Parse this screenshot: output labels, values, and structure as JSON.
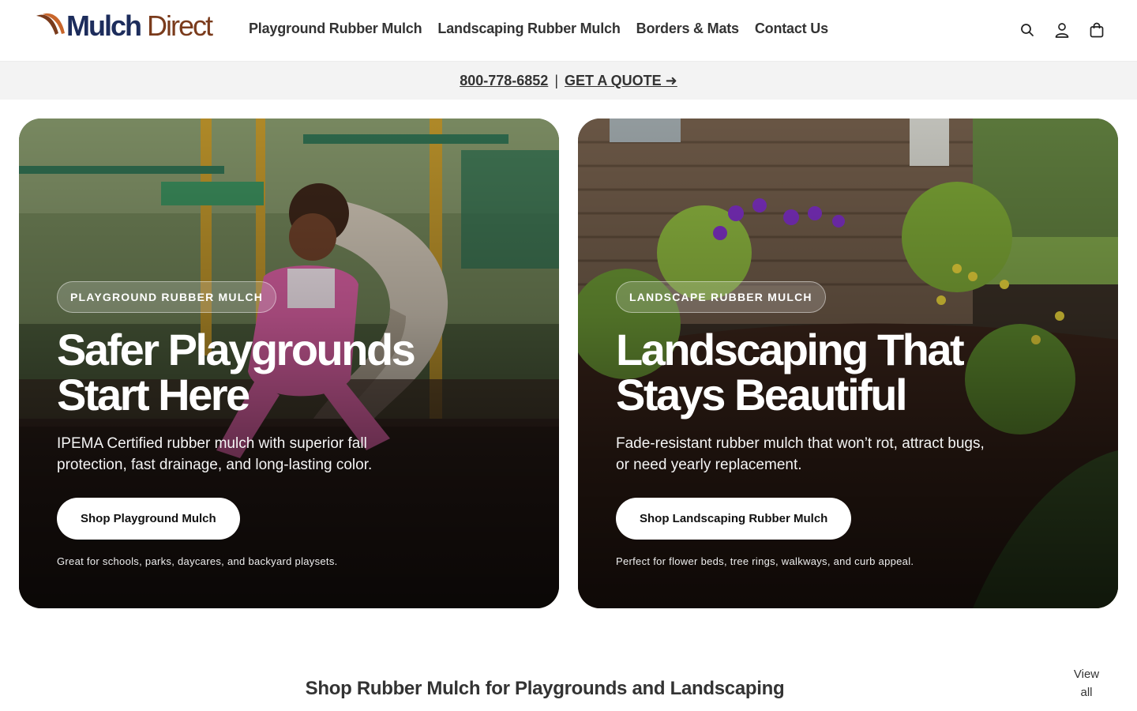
{
  "brand": {
    "name": "MulchDirect",
    "part1": "Mulch",
    "part2": "Direct",
    "colors": {
      "brown": "#7a3b1c",
      "navy": "#1d2d5c",
      "orange": "#c8652a"
    }
  },
  "nav": [
    {
      "label": "Playground Rubber Mulch"
    },
    {
      "label": "Landscaping Rubber Mulch"
    },
    {
      "label": "Borders & Mats"
    },
    {
      "label": "Contact Us"
    }
  ],
  "header_icons": [
    "search-icon",
    "account-icon",
    "cart-icon"
  ],
  "announcement": {
    "phone": "800-778-6852",
    "separator": "|",
    "quote": "GET A QUOTE ➜"
  },
  "cards": [
    {
      "tag": "PLAYGROUND RUBBER MULCH",
      "headline": "Safer Playgrounds Start Here",
      "subtext": "IPEMA Certified rubber mulch with superior fall protection, fast drainage, and long-lasting color.",
      "cta": "Shop Playground Mulch",
      "note": "Great for schools, parks, daycares, and backyard playsets."
    },
    {
      "tag": "LANDSCAPE RUBBER MULCH",
      "headline": "Landscaping That Stays Beautiful",
      "subtext": "Fade-resistant rubber mulch that won’t rot, attract bugs, or need yearly replacement.",
      "cta": "Shop Landscaping Rubber Mulch",
      "note": "Perfect for flower beds, tree rings, walkways, and curb appeal."
    }
  ],
  "section": {
    "title": "Shop Rubber Mulch for Playgrounds and Landscaping",
    "view_all": "View all"
  }
}
